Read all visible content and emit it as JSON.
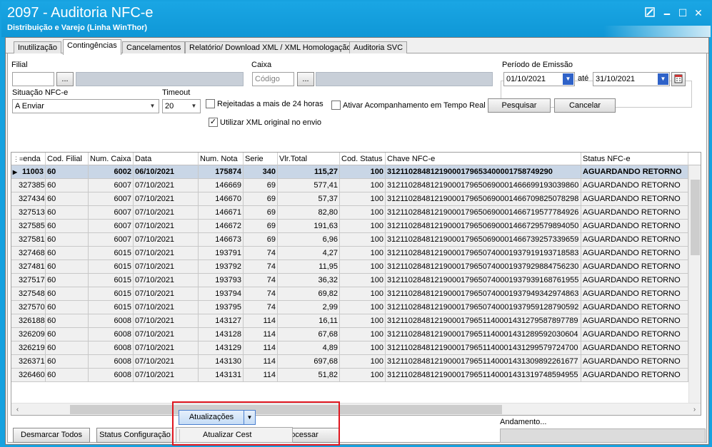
{
  "window": {
    "title": "2097 - Auditoria NFC-e",
    "subtitle": "Distribuição e Varejo (Linha WinThor)",
    "controls": {
      "minimize": "🗕",
      "maximize": "☐",
      "close": "✕"
    }
  },
  "tabs": [
    "Inutilização",
    "Contingências",
    "Cancelamentos",
    "Relatório/ Download XML / XML Homologação",
    "Auditoria SVC"
  ],
  "active_tab": "Contingências",
  "filters": {
    "filial_label": "Filial",
    "filial_value": "",
    "caixa_label": "Caixa",
    "caixa_placeholder": "Código",
    "ellipsis": "...",
    "periodo_label": "Período de Emissão",
    "date_start": "01/10/2021",
    "ate_label": "até",
    "date_end": "31/10/2021",
    "situacao_label": "Situação NFC-e",
    "situacao_value": "A Enviar",
    "timeout_label": "Timeout",
    "timeout_value": "20",
    "rejeitadas_label": "Rejeitadas a mais de 24 horas",
    "rejeitadas_checked": false,
    "utilizar_xml_label": "Utilizar XML original no envio",
    "utilizar_xml_checked": true,
    "acompanhamento_label": "Ativar Acompanhamento em Tempo Real",
    "acompanhamento_checked": false,
    "pesquisar_label": "Pesquisar",
    "cancelar_label": "Cancelar"
  },
  "grid": {
    "columns": [
      "enda",
      "Cod. Filial",
      "Num. Caixa",
      "Data",
      "Num. Nota",
      "Serie",
      "Vlr.Total",
      "Cod. Status",
      "Chave NFC-e",
      "Status NFC-e"
    ],
    "rows": [
      [
        "11003",
        "60",
        "6002",
        "06/10/2021",
        "175874",
        "340",
        "115,27",
        "100",
        "31211028481219000179653400001758749290",
        "AGUARDANDO RETORNO"
      ],
      [
        "327385",
        "60",
        "6007",
        "07/10/2021",
        "146669",
        "69",
        "577,41",
        "100",
        "31211028481219000179650690001466699193039860",
        "AGUARDANDO RETORNO"
      ],
      [
        "327434",
        "60",
        "6007",
        "07/10/2021",
        "146670",
        "69",
        "57,37",
        "100",
        "31211028481219000179650690001466709825078298",
        "AGUARDANDO RETORNO"
      ],
      [
        "327513",
        "60",
        "6007",
        "07/10/2021",
        "146671",
        "69",
        "82,80",
        "100",
        "31211028481219000179650690001466719577784926",
        "AGUARDANDO RETORNO"
      ],
      [
        "327585",
        "60",
        "6007",
        "07/10/2021",
        "146672",
        "69",
        "191,63",
        "100",
        "31211028481219000179650690001466729579894050",
        "AGUARDANDO RETORNO"
      ],
      [
        "327581",
        "60",
        "6007",
        "07/10/2021",
        "146673",
        "69",
        "6,96",
        "100",
        "31211028481219000179650690001466739257339659",
        "AGUARDANDO RETORNO"
      ],
      [
        "327468",
        "60",
        "6015",
        "07/10/2021",
        "193791",
        "74",
        "4,27",
        "100",
        "31211028481219000179650740001937919193718583",
        "AGUARDANDO RETORNO"
      ],
      [
        "327481",
        "60",
        "6015",
        "07/10/2021",
        "193792",
        "74",
        "11,95",
        "100",
        "31211028481219000179650740001937929884756230",
        "AGUARDANDO RETORNO"
      ],
      [
        "327517",
        "60",
        "6015",
        "07/10/2021",
        "193793",
        "74",
        "36,32",
        "100",
        "31211028481219000179650740001937939168761955",
        "AGUARDANDO RETORNO"
      ],
      [
        "327548",
        "60",
        "6015",
        "07/10/2021",
        "193794",
        "74",
        "69,82",
        "100",
        "31211028481219000179650740001937949342974863",
        "AGUARDANDO RETORNO"
      ],
      [
        "327570",
        "60",
        "6015",
        "07/10/2021",
        "193795",
        "74",
        "2,99",
        "100",
        "31211028481219000179650740001937959128790592",
        "AGUARDANDO RETORNO"
      ],
      [
        "326188",
        "60",
        "6008",
        "07/10/2021",
        "143127",
        "114",
        "16,11",
        "100",
        "31211028481219000179651140001431279587897789",
        "AGUARDANDO RETORNO"
      ],
      [
        "326209",
        "60",
        "6008",
        "07/10/2021",
        "143128",
        "114",
        "67,68",
        "100",
        "31211028481219000179651140001431289592030604",
        "AGUARDANDO RETORNO"
      ],
      [
        "326219",
        "60",
        "6008",
        "07/10/2021",
        "143129",
        "114",
        "4,89",
        "100",
        "31211028481219000179651140001431299579724700",
        "AGUARDANDO RETORNO"
      ],
      [
        "326371",
        "60",
        "6008",
        "07/10/2021",
        "143130",
        "114",
        "697,68",
        "100",
        "31211028481219000179651140001431309892261677",
        "AGUARDANDO RETORNO"
      ],
      [
        "326460",
        "60",
        "6008",
        "07/10/2021",
        "143131",
        "114",
        "51,82",
        "100",
        "31211028481219000179651140001431319748594955",
        "AGUARDANDO RETORNO"
      ]
    ]
  },
  "bottom": {
    "desmarcar_label": "Desmarcar Todos",
    "status_config_label": "Status Configuração",
    "atualizacoes_label": "Atualizações",
    "processar_label": "Processar",
    "andamento_label": "Andamento...",
    "dropdown_item": "Atualizar Cest"
  },
  "colors": {
    "titlebar": "#17a2e0",
    "highlight": "#e0161f",
    "selected_row": "#c9d6e6"
  }
}
